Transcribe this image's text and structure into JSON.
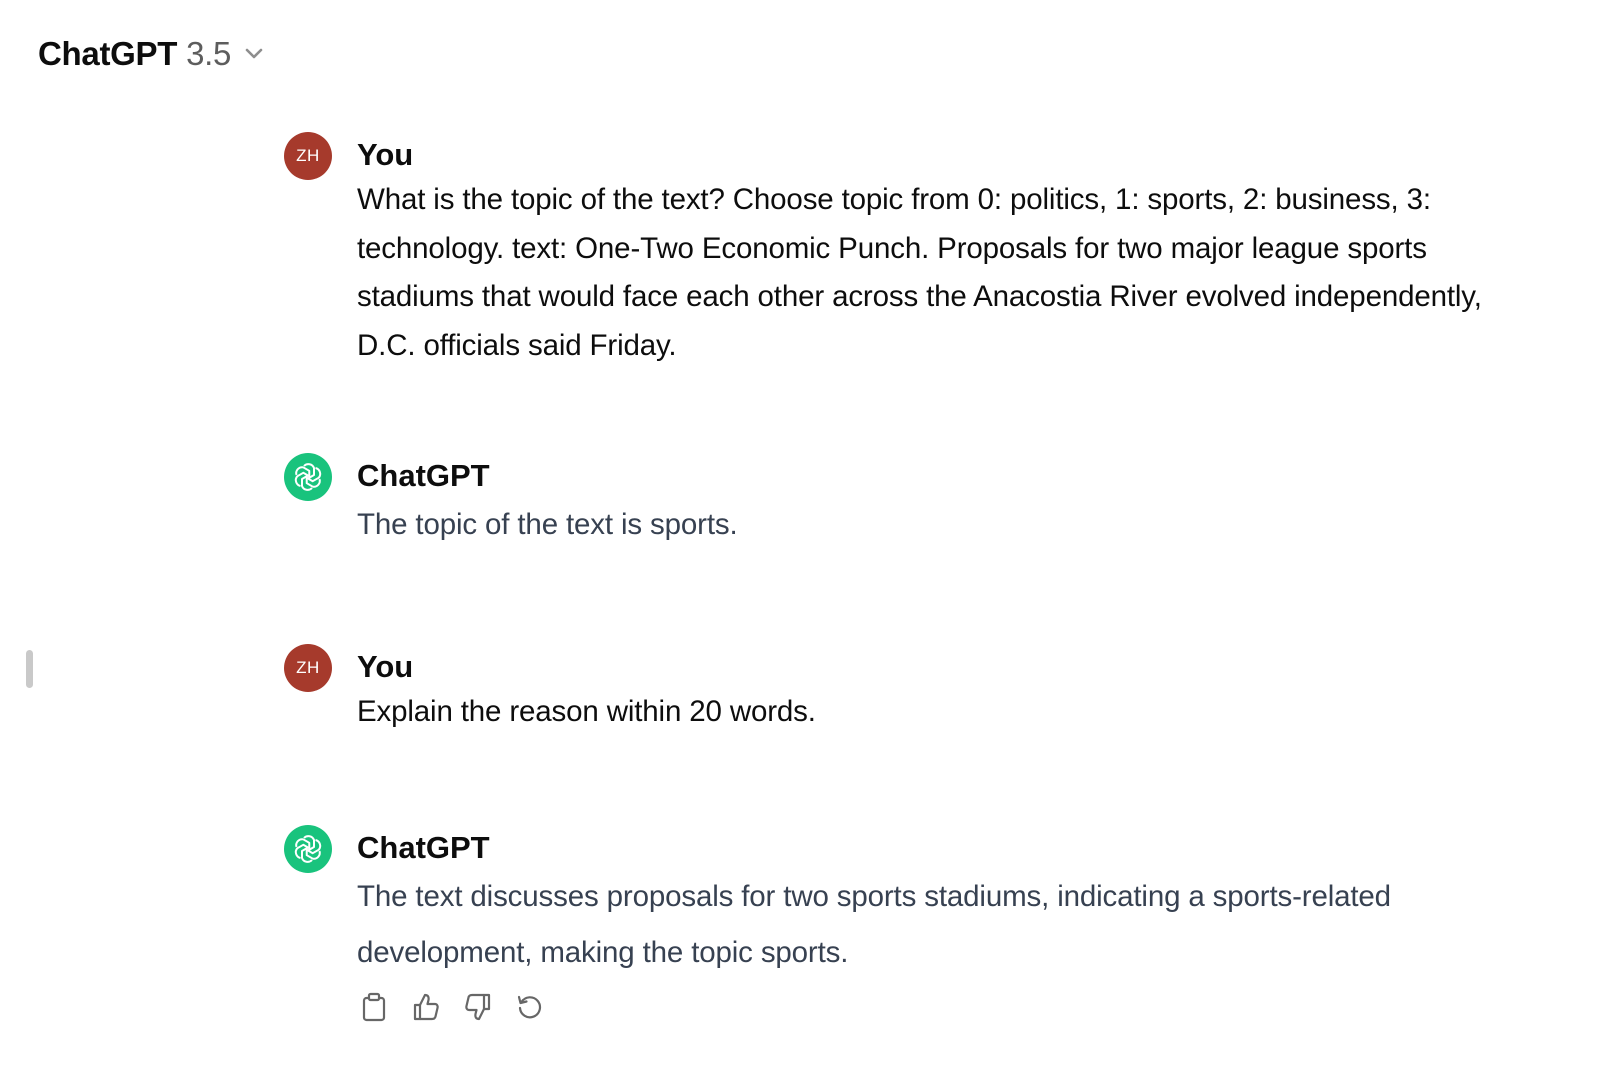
{
  "header": {
    "model_name": "ChatGPT",
    "model_version": "3.5"
  },
  "messages": [
    {
      "role": "user",
      "avatar_initials": "ZH",
      "author": "You",
      "text": "What is the topic of the text? Choose topic from 0: politics, 1: sports, 2: business, 3: technology.  text: One-Two Economic Punch. Proposals for two major league sports stadiums that would face each other across the Anacostia River evolved independently, D.C. officials said Friday."
    },
    {
      "role": "assistant",
      "author": "ChatGPT",
      "icon": "openai-logo-icon",
      "text": "The topic of the text is sports."
    },
    {
      "role": "user",
      "avatar_initials": "ZH",
      "author": "You",
      "text": "Explain the reason within 20 words."
    },
    {
      "role": "assistant",
      "author": "ChatGPT",
      "icon": "openai-logo-icon",
      "text": "The text discusses proposals for two sports stadiums, indicating a sports-related development, making the topic sports."
    }
  ],
  "response_actions": [
    "copy-icon",
    "thumbs-up-icon",
    "thumbs-down-icon",
    "regenerate-icon"
  ],
  "colors": {
    "user_avatar": "#a63a2c",
    "assistant_avatar": "#19c37d",
    "assistant_text": "#374151",
    "icon_gray": "#676767"
  }
}
